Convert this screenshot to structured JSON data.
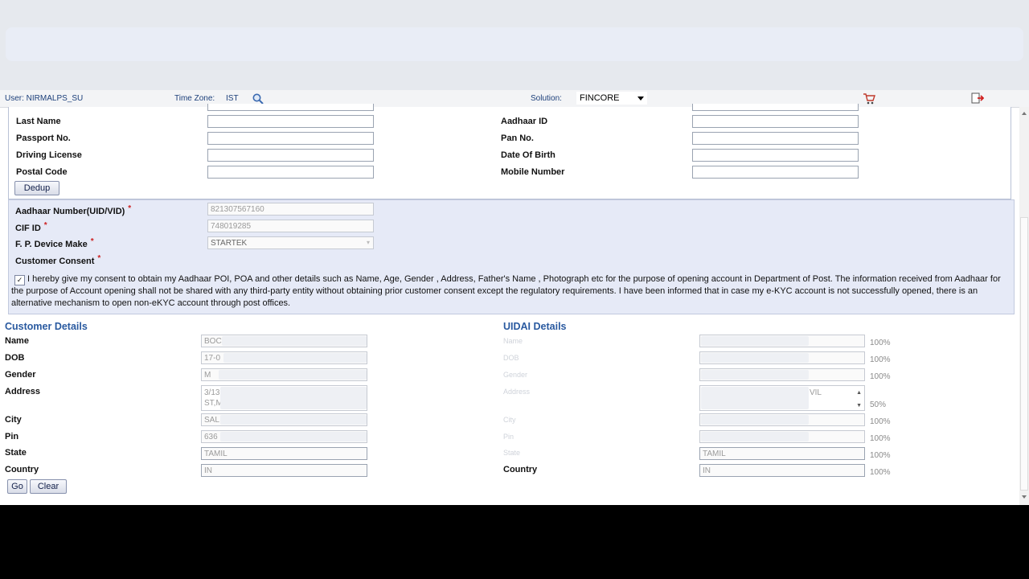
{
  "infobar": {
    "user": "User: NIRMALPS_SU",
    "timezone_label": "Time Zone:",
    "timezone_value": "IST",
    "solution_label": "Solution:",
    "solution_value": "FINCORE"
  },
  "dedup": {
    "fields": {
      "last_name": "Last Name",
      "aadhaar_id": "Aadhaar ID",
      "passport_no": "Passport No.",
      "pan_no": "Pan No.",
      "driving_license": "Driving License",
      "date_of_birth": "Date Of Birth",
      "postal_code": "Postal Code",
      "mobile_number": "Mobile Number"
    },
    "button": "Dedup"
  },
  "ekyc": {
    "aadhaar_label": "Aadhaar Number(UID/VID)",
    "aadhaar_value": "821307567160",
    "cif_label": "CIF ID",
    "cif_value": "748019285",
    "device_label": "F. P. Device Make",
    "device_value": "STARTEK",
    "consent_label": "Customer Consent",
    "required_mark": "*",
    "consent_checked": "✓",
    "consent_text": "I hereby give my consent to obtain my Aadhaar POI, POA and other details such as Name, Age, Gender , Address, Father's Name , Photograph etc for the purpose of opening account in Department of Post. The information received from Aadhaar for the purpose of Account opening shall not be shared with any third-party entity without obtaining prior customer consent except the regulatory requirements. I have been informed that in case my e-KYC account is not successfully opened, there is an alternative mechanism to open non-eKYC account through post offices."
  },
  "customer_details": {
    "title": "Customer Details",
    "name_label": "Name",
    "name_value": "BOC",
    "dob_label": "DOB",
    "dob_value": "17-0",
    "gender_label": "Gender",
    "gender_value": "M",
    "address_label": "Address",
    "address_line1": "3/13,",
    "address_line2": "ST,M",
    "city_label": "City",
    "city_value": "SAL",
    "pin_label": "Pin",
    "pin_value": "636",
    "state_label": "State",
    "state_value": "TAMIL",
    "country_label": "Country",
    "country_value": "IN"
  },
  "uidai_details": {
    "title": "UIDAI Details",
    "name_label": "Name",
    "dob_label": "DOB",
    "gender_label": "Gender",
    "address_label": "Address",
    "address_line1": "VIL",
    "city_label": "City",
    "pin_label": "Pin",
    "state_label": "State",
    "state_value": "TAMIL",
    "country_label": "Country",
    "country_value": "IN",
    "match_name": "100%",
    "match_dob": "100%",
    "match_gender": "100%",
    "match_address": "50%",
    "match_city": "100%",
    "match_pin": "100%",
    "match_state": "100%",
    "match_country": "100%"
  },
  "actions": {
    "go": "Go",
    "clear": "Clear"
  },
  "colors": {
    "accent": "#2a5aa0",
    "panel": "#e6eaf7",
    "required": "#cc2222"
  }
}
